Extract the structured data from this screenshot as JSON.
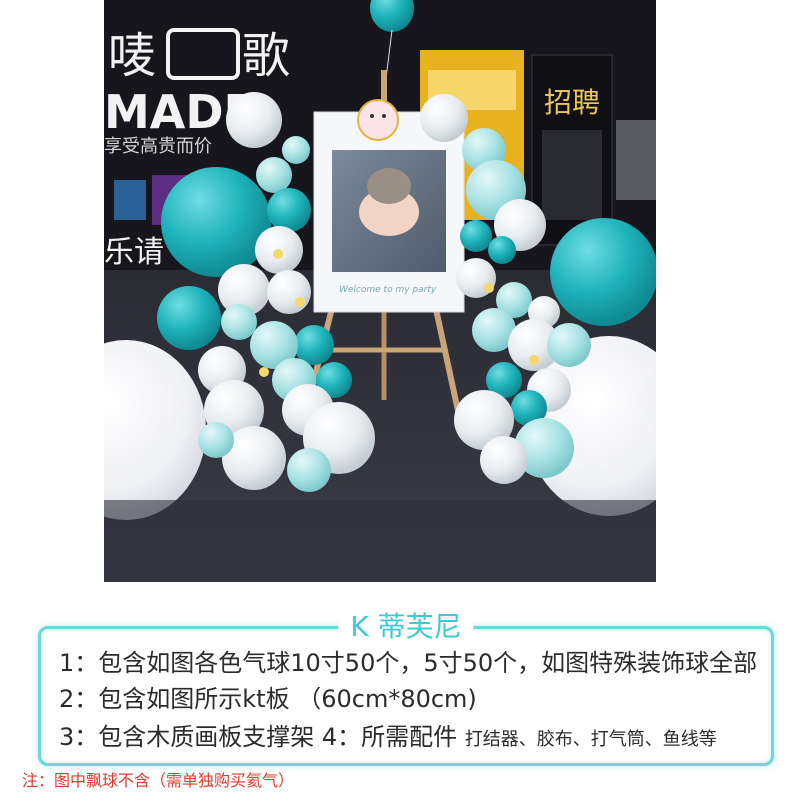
{
  "photo": {
    "bg_sign_chars": [
      "唛",
      "歌"
    ],
    "bg_brand": "MADE",
    "bg_slogan": "享受高贵而价",
    "bg_slogan2": "乐请",
    "poster_title": "招聘",
    "kt_board_caption": "Welcome to my party",
    "colors": {
      "teal": "#1fb3bb",
      "light_teal": "#a8e2e4",
      "white_balloon": "#eef1f3"
    }
  },
  "info": {
    "title": "K 蒂芙尼",
    "line1": "1：包含如图各色气球10寸50个，5寸50个，如图特殊装饰球全部",
    "line2": "2：包含如图所示kt板 （60cm*80cm)",
    "line3_main": "3：包含木质画板支撑架  4：所需配件",
    "line3_small": "打结器、胶布、打气筒、鱼线等",
    "accent_color": "#3dcbd3"
  },
  "footnote": "注：图中飘球不含（需单独购买氦气）"
}
